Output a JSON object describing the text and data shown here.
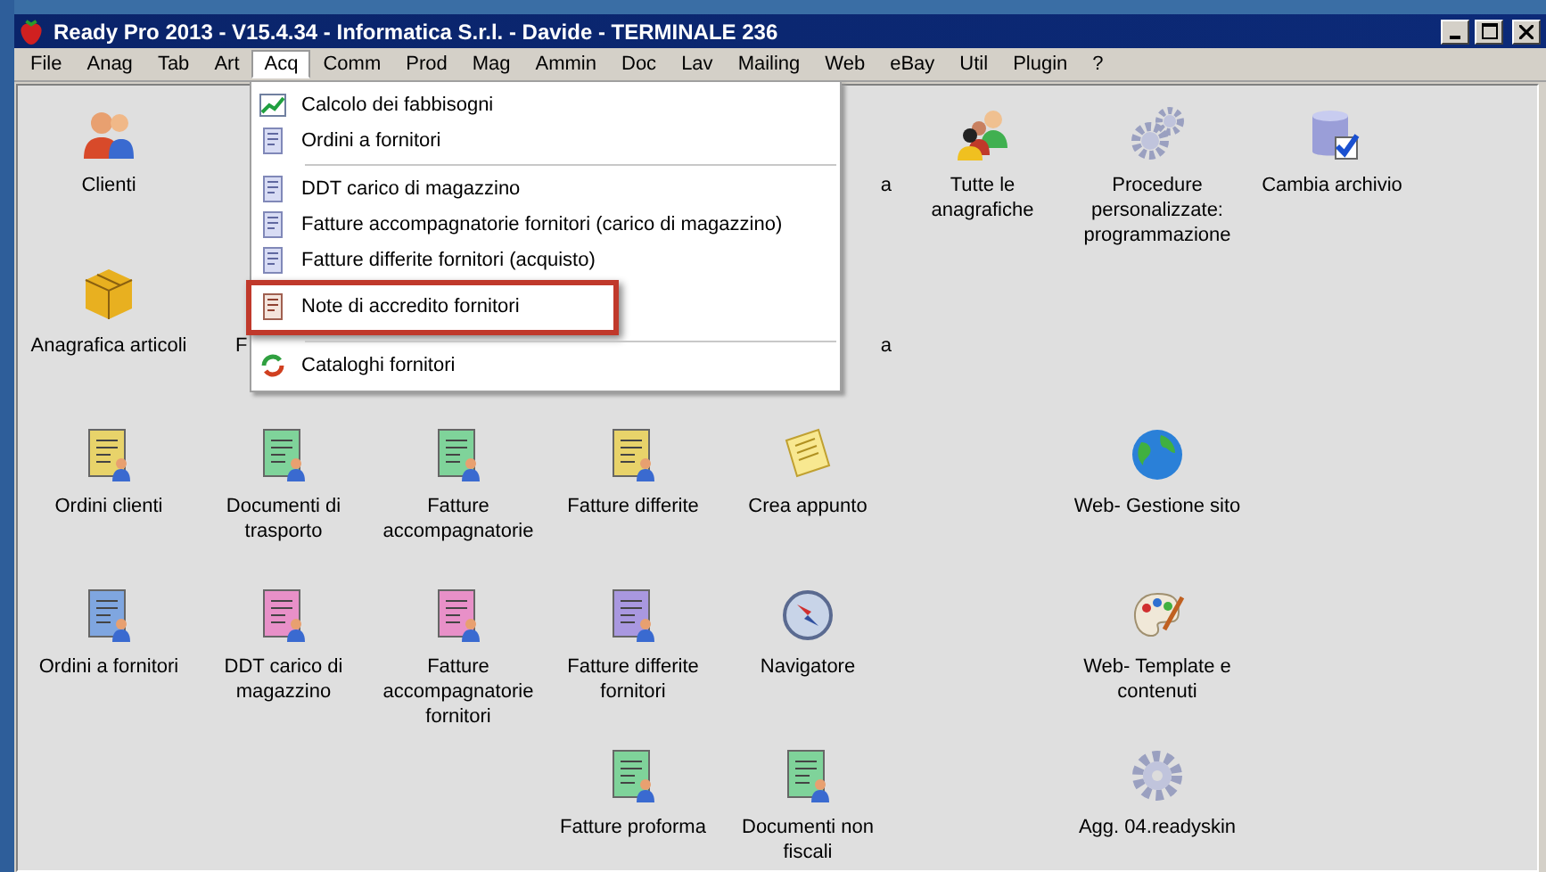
{
  "window": {
    "title": "Ready Pro 2013 - V15.4.34 - Informatica S.r.l. - Davide - TERMINALE 236"
  },
  "menubar": [
    {
      "label": "File",
      "selected": false
    },
    {
      "label": "Anag",
      "selected": false
    },
    {
      "label": "Tab",
      "selected": false
    },
    {
      "label": "Art",
      "selected": false
    },
    {
      "label": "Acq",
      "selected": true
    },
    {
      "label": "Comm",
      "selected": false
    },
    {
      "label": "Prod",
      "selected": false
    },
    {
      "label": "Mag",
      "selected": false
    },
    {
      "label": "Ammin",
      "selected": false
    },
    {
      "label": "Doc",
      "selected": false
    },
    {
      "label": "Lav",
      "selected": false
    },
    {
      "label": "Mailing",
      "selected": false
    },
    {
      "label": "Web",
      "selected": false
    },
    {
      "label": "eBay",
      "selected": false
    },
    {
      "label": "Util",
      "selected": false
    },
    {
      "label": "Plugin",
      "selected": false
    },
    {
      "label": "?",
      "selected": false
    }
  ],
  "menu": {
    "items": [
      {
        "kind": "chart",
        "label": "Calcolo dei fabbisogni",
        "annotated": false
      },
      {
        "kind": "doc",
        "label": "Ordini a fornitori",
        "annotated": false
      },
      {
        "kind": "separator"
      },
      {
        "kind": "doc",
        "label": "DDT carico di magazzino",
        "annotated": false
      },
      {
        "kind": "doc",
        "label": "Fatture accompagnatorie fornitori (carico di magazzino)",
        "annotated": false
      },
      {
        "kind": "doc",
        "label": "Fatture differite fornitori (acquisto)",
        "annotated": false
      },
      {
        "kind": "note",
        "label": "Note di accredito fornitori",
        "annotated": true
      },
      {
        "kind": "separator"
      },
      {
        "kind": "cycle",
        "label": "Cataloghi fornitori",
        "annotated": false
      }
    ]
  },
  "desktop": {
    "rows": [
      [
        {
          "kind": "people",
          "label": "Clienti"
        },
        null,
        null,
        null,
        {
          "kind": "cut_end",
          "label": "a"
        },
        {
          "kind": "group",
          "label": "Tutte le anagrafiche"
        },
        {
          "kind": "gears",
          "label": "Procedure personalizzate: programmazione"
        },
        {
          "kind": "database",
          "label": "Cambia archivio"
        }
      ],
      [
        {
          "kind": "box",
          "label": "Anagrafica articoli"
        },
        {
          "kind": "cut_start",
          "label": "F"
        },
        null,
        null,
        {
          "kind": "cut_end",
          "label": "a"
        },
        null,
        null,
        null
      ],
      [
        {
          "kind": "doc",
          "color": "#e8d36a",
          "label": "Ordini clienti"
        },
        {
          "kind": "doc",
          "color": "#7fd39a",
          "label": "Documenti di trasporto"
        },
        {
          "kind": "doc",
          "color": "#7fd39a",
          "label": "Fatture accompagnatorie"
        },
        {
          "kind": "doc",
          "color": "#e8d36a",
          "label": "Fatture differite"
        },
        {
          "kind": "memo",
          "label": "Crea appunto"
        },
        null,
        {
          "kind": "globe",
          "label": "Web- Gestione sito"
        },
        null
      ],
      [
        {
          "kind": "doc",
          "color": "#7fa6e0",
          "label": "Ordini a fornitori"
        },
        {
          "kind": "doc",
          "color": "#e890c8",
          "label": "DDT carico di magazzino"
        },
        {
          "kind": "doc",
          "color": "#e890c8",
          "label": "Fatture accompagnatorie fornitori"
        },
        {
          "kind": "doc",
          "color": "#a998e0",
          "label": "Fatture differite fornitori"
        },
        {
          "kind": "compass",
          "label": "Navigatore"
        },
        null,
        {
          "kind": "palette",
          "label": "Web- Template e contenuti"
        },
        null
      ],
      [
        null,
        null,
        null,
        {
          "kind": "doc",
          "color": "#7fd39a",
          "label": "Fatture proforma"
        },
        {
          "kind": "doc",
          "color": "#7fd39a",
          "label": "Documenti non fiscali"
        },
        null,
        {
          "kind": "gear",
          "label": "Agg. 04.readyskin"
        },
        null
      ]
    ]
  }
}
